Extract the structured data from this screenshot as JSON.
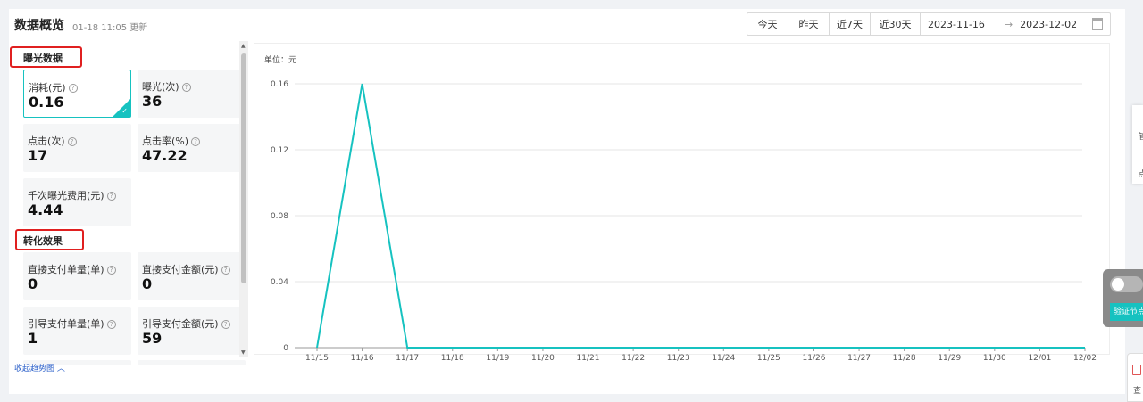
{
  "header": {
    "title": "数据概览",
    "updated": "01-18 11:05 更新"
  },
  "date_filter": {
    "today": "今天",
    "yesterday": "昨天",
    "last7": "近7天",
    "last30": "近30天",
    "start": "2023-11-16",
    "arrow": "→",
    "end": "2023-12-02"
  },
  "sections": {
    "exposure": "曝光数据",
    "conversion": "转化效果"
  },
  "metrics": [
    {
      "label": "消耗(元)",
      "value": "0.16"
    },
    {
      "label": "曝光(次)",
      "value": "36"
    },
    {
      "label": "点击(次)",
      "value": "17"
    },
    {
      "label": "点击率(%)",
      "value": "47.22"
    },
    {
      "label": "千次曝光费用(元)",
      "value": "4.44"
    },
    {
      "label": "直接支付单量(单)",
      "value": "0"
    },
    {
      "label": "直接支付金额(元)",
      "value": "0"
    },
    {
      "label": "引导支付单量(单)",
      "value": "1"
    },
    {
      "label": "引导支付金额(元)",
      "value": "59"
    }
  ],
  "collapse_label": "收起趋势图 ︿",
  "chart_unit": "单位：元",
  "chart_data": {
    "type": "line",
    "x": [
      "11/15",
      "11/16",
      "11/17",
      "11/18",
      "11/19",
      "11/20",
      "11/21",
      "11/22",
      "11/23",
      "11/24",
      "11/25",
      "11/26",
      "11/27",
      "11/28",
      "11/29",
      "11/30",
      "12/01",
      "12/02"
    ],
    "series": [
      {
        "values": [
          0,
          0.16,
          0,
          0,
          0,
          0,
          0,
          0,
          0,
          0,
          0,
          0,
          0,
          0,
          0,
          0,
          0,
          0
        ]
      }
    ],
    "yticks": [
      "0",
      "0.04",
      "0.08",
      "0.12",
      "0.16"
    ],
    "ylim": [
      0,
      0.16
    ],
    "grid": true,
    "color": "#16c2c0"
  },
  "side": {
    "verify_button": "验证节点",
    "side_text1": "管",
    "side_text2": "点",
    "corner_text": "查"
  }
}
